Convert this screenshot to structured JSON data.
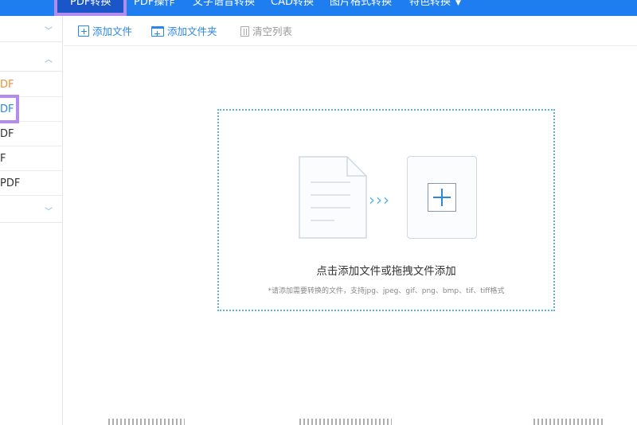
{
  "nav": {
    "items": [
      {
        "label": "PDF转换",
        "active": true
      },
      {
        "label": "PDF操作"
      },
      {
        "label": "文字语音转换"
      },
      {
        "label": "CAD转换"
      },
      {
        "label": "图片格式转换"
      },
      {
        "label": "特色转换"
      }
    ]
  },
  "sidebar": {
    "items": [
      "DF",
      "DF",
      "DF",
      "F",
      "PDF"
    ]
  },
  "toolbar": {
    "add_file": "添加文件",
    "add_folder": "添加文件夹",
    "clear_list": "清空列表"
  },
  "dropzone": {
    "main_text": "点击添加文件或拖拽文件添加",
    "sub_text": "*请添加需要转换的文件，支持jpg、jpeg、gif、png、bmp、tif、tiff格式"
  },
  "colors": {
    "nav_bg": "#1e7ef0",
    "accent": "#2a86e8",
    "highlight": "#b48cf0",
    "dropzone_border": "#5bb4e0"
  }
}
